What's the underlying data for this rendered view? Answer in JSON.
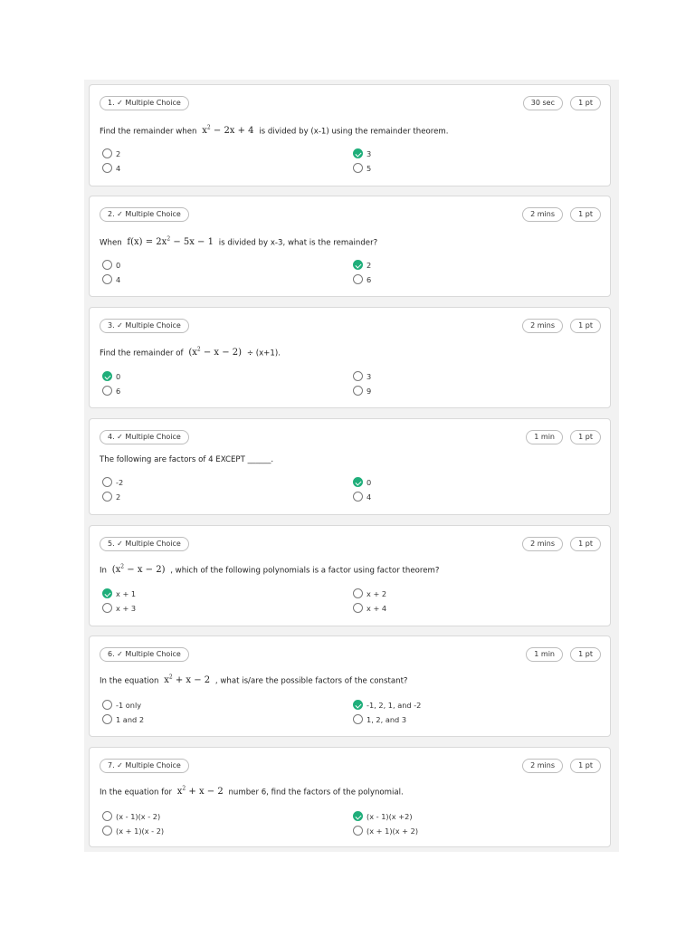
{
  "questions": [
    {
      "type_label": "1. ✓ Multiple Choice",
      "time": "30 sec",
      "points": "1 pt",
      "pre": "Find the remainder when",
      "post": "is divided by (x-1) using the remainder theorem.",
      "options": [
        "2",
        "3",
        "4",
        "5"
      ],
      "correct": 1
    },
    {
      "type_label": "2. ✓ Multiple Choice",
      "time": "2 mins",
      "points": "1 pt",
      "pre": "When",
      "post": "is divided by x-3, what is the remainder?",
      "options": [
        "0",
        "2",
        "4",
        "6"
      ],
      "correct": 1
    },
    {
      "type_label": "3. ✓ Multiple Choice",
      "time": "2 mins",
      "points": "1 pt",
      "pre": "Find the remainder of",
      "post": "÷ (x+1).",
      "options": [
        "0",
        "3",
        "6",
        "9"
      ],
      "correct": 0
    },
    {
      "type_label": "4. ✓ Multiple Choice",
      "time": "1 min",
      "points": "1 pt",
      "pre": "The following are factors of 4 EXCEPT ______.",
      "post": "",
      "options": [
        "-2",
        "0",
        "2",
        "4"
      ],
      "correct": 1
    },
    {
      "type_label": "5. ✓ Multiple Choice",
      "time": "2 mins",
      "points": "1 pt",
      "pre": "In",
      "post": ", which of the following polynomials is a factor using factor theorem?",
      "options": [
        "x + 1",
        "x + 2",
        "x + 3",
        "x + 4"
      ],
      "correct": 0
    },
    {
      "type_label": "6. ✓ Multiple Choice",
      "time": "1 min",
      "points": "1 pt",
      "pre": "In the equation",
      "post": ", what is/are the possible factors of the constant?",
      "options": [
        "-1 only",
        "-1, 2, 1, and -2",
        "1 and 2",
        "1, 2, and 3"
      ],
      "correct": 1
    },
    {
      "type_label": "7. ✓ Multiple Choice",
      "time": "2 mins",
      "points": "1 pt",
      "pre": "In the equation for",
      "post": "number 6, find the factors of the polynomial.",
      "options": [
        "(x - 1)(x - 2)",
        "(x - 1)(x +2)",
        "(x + 1)(x - 2)",
        "(x + 1)(x + 2)"
      ],
      "correct": 1
    }
  ]
}
